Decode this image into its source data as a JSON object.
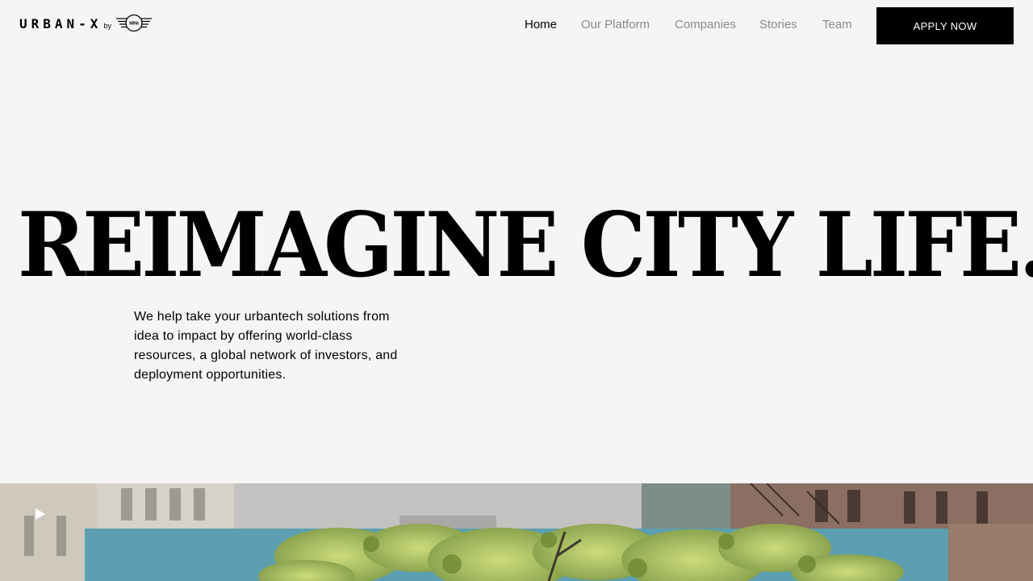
{
  "header": {
    "logo_text": "URBAN-X",
    "logo_by": "by",
    "logo_badge": "MINI"
  },
  "nav": {
    "items": [
      {
        "label": "Home",
        "active": true
      },
      {
        "label": "Our Platform",
        "active": false
      },
      {
        "label": "Companies",
        "active": false
      },
      {
        "label": "Stories",
        "active": false
      },
      {
        "label": "Team",
        "active": false
      }
    ],
    "apply_label": "APPLY NOW"
  },
  "hero": {
    "title": "REIMAGINE CITY LIFE.",
    "description": "We help take your urbantech solutions from idea to impact by offering world-class resources, a global network of investors, and deployment opportunities."
  },
  "video": {
    "play_icon": "play-icon"
  },
  "colors": {
    "background": "#f5f5f5",
    "text": "#000000",
    "nav_inactive": "#8a8a8a",
    "button_bg": "#000000",
    "button_text": "#ffffff"
  }
}
